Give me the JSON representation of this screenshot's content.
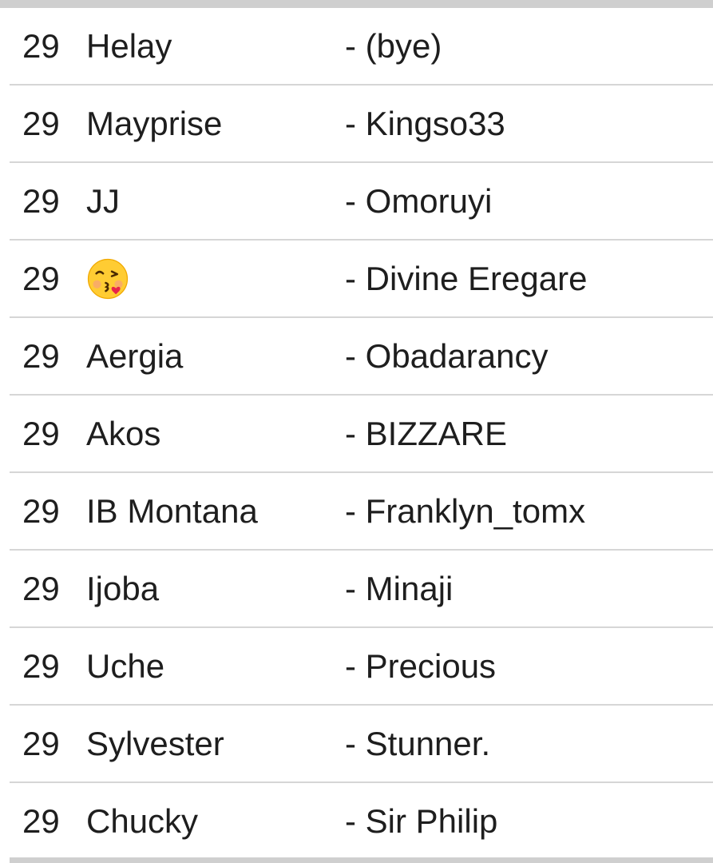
{
  "rows": [
    {
      "number": "29",
      "name": "Helay",
      "partner": "- (bye)"
    },
    {
      "number": "29",
      "name": "Mayprise",
      "partner": "- Kingso33"
    },
    {
      "number": "29",
      "name": "JJ",
      "partner": "- Omoruyi"
    },
    {
      "number": "29",
      "name": "",
      "name_icon": "face-blowing-a-kiss-emoji",
      "partner": "- Divine Eregare"
    },
    {
      "number": "29",
      "name": "Aergia",
      "partner": "- Obadarancy"
    },
    {
      "number": "29",
      "name": "Akos",
      "partner": "- BIZZARE"
    },
    {
      "number": "29",
      "name": "IB Montana",
      "partner": "- Franklyn_tomx"
    },
    {
      "number": "29",
      "name": "Ijoba",
      "partner": "- Minaji"
    },
    {
      "number": "29",
      "name": "Uche",
      "partner": "- Precious"
    },
    {
      "number": "29",
      "name": "Sylvester",
      "partner": "- Stunner."
    },
    {
      "number": "29",
      "name": "Chucky",
      "partner": "- Sir Philip"
    }
  ],
  "colors": {
    "text": "#1e1e1e",
    "divider": "#d6d6d6",
    "border": "#cfcfcf",
    "background": "#ffffff"
  }
}
